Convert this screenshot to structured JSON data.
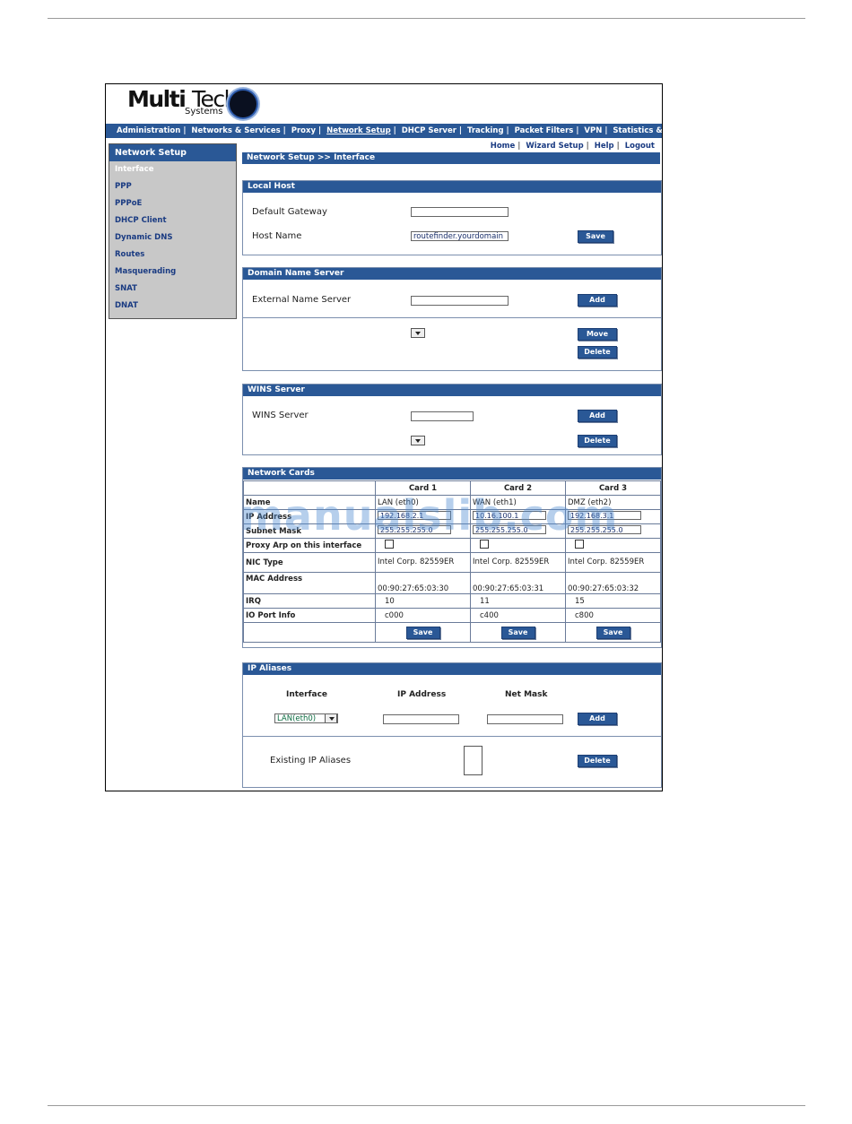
{
  "logo": {
    "brand_bold": "Multi",
    "brand_light": "Tech",
    "sub": "Systems"
  },
  "topnav": [
    "Administration",
    "Networks & Services",
    "Proxy",
    "Network Setup",
    "DHCP Server",
    "Tracking",
    "Packet Filters",
    "VPN",
    "Statistics & Logs"
  ],
  "util_links": [
    "Home",
    "Wizard Setup",
    "Help",
    "Logout"
  ],
  "sidebar": {
    "title": "Network Setup",
    "items": [
      "Interface",
      "PPP",
      "PPPoE",
      "DHCP Client",
      "Dynamic DNS",
      "Routes",
      "Masquerading",
      "SNAT",
      "DNAT"
    ]
  },
  "breadcrumb": "Network Setup >> Interface",
  "local_host": {
    "title": "Local Host",
    "gateway_label": "Default Gateway",
    "gateway_value": "",
    "host_label": "Host Name",
    "host_value": "routefinder.yourdomain",
    "save": "Save"
  },
  "dns": {
    "title": "Domain Name Server",
    "ext_label": "External Name Server",
    "ext_value": "",
    "add": "Add",
    "move": "Move",
    "delete": "Delete"
  },
  "wins": {
    "title": "WINS Server",
    "label": "WINS Server",
    "value": "",
    "add": "Add",
    "delete": "Delete"
  },
  "network_cards": {
    "title": "Network Cards",
    "headers": [
      "Card 1",
      "Card 2",
      "Card 3"
    ],
    "row_labels": {
      "name": "Name",
      "address": "IP Address",
      "subnet": "Subnet Mask",
      "proxy_arp": "Proxy Arp on this interface",
      "nic": "NIC Type",
      "mac": "MAC Address",
      "irq": "IRQ",
      "io": "IO Port Info"
    },
    "cards": [
      {
        "name": "LAN (eth0)",
        "address": "192.168.2.1",
        "subnet": "255.255.255.0",
        "nic": "Intel Corp. 82559ER",
        "mac": "00:90:27:65:03:30",
        "irq": "10",
        "io": "c000"
      },
      {
        "name": "WAN (eth1)",
        "address": "10.16.100.1",
        "subnet": "255.255.255.0",
        "nic": "Intel Corp. 82559ER",
        "mac": "00:90:27:65:03:31",
        "irq": "11",
        "io": "c400"
      },
      {
        "name": "DMZ (eth2)",
        "address": "192.168.3.1",
        "subnet": "255.255.255.0",
        "nic": "Intel Corp. 82559ER",
        "mac": "00:90:27:65:03:32",
        "irq": "15",
        "io": "c800"
      }
    ],
    "save": "Save"
  },
  "ip_aliases": {
    "title": "IP Aliases",
    "col_interface": "Interface",
    "col_ip": "IP Address",
    "col_mask": "Net Mask",
    "interface_selected": "LAN(eth0)",
    "ip_value": "",
    "mask_value": "",
    "add": "Add",
    "existing_label": "Existing IP Aliases",
    "delete": "Delete"
  },
  "watermark": "manualslib.com"
}
